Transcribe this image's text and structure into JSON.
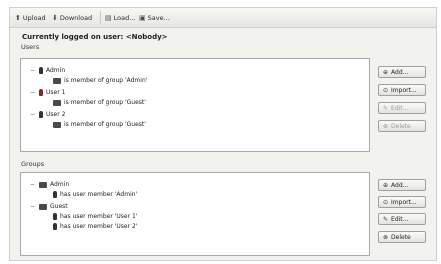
{
  "toolbar": {
    "upload": {
      "icon": "upload-icon",
      "label": "Upload"
    },
    "download": {
      "icon": "download-icon",
      "label": "Download"
    },
    "load": {
      "icon": "load-icon",
      "label": "Load..."
    },
    "save": {
      "icon": "save-icon",
      "label": "Save..."
    }
  },
  "status": "Currently logged on user: <Nobody>",
  "users_section": {
    "label": "Users",
    "tree": [
      {
        "type": "user",
        "label": "Admin",
        "expanded": true
      },
      {
        "type": "group",
        "label": "is member of group 'Admin'"
      },
      {
        "type": "user",
        "label": "User 1",
        "expanded": true
      },
      {
        "type": "group",
        "label": "is member of group 'Guest'"
      },
      {
        "type": "user",
        "label": "User 2",
        "expanded": true
      },
      {
        "type": "group",
        "label": "is member of group 'Guest'"
      }
    ],
    "buttons": {
      "add": {
        "label": "Add...",
        "icon": "add-icon",
        "enabled": true
      },
      "import": {
        "label": "Import...",
        "icon": "import-icon",
        "enabled": true
      },
      "edit": {
        "label": "Edit...",
        "icon": "edit-icon",
        "enabled": false
      },
      "delete": {
        "label": "Delete",
        "icon": "delete-icon",
        "enabled": false
      }
    }
  },
  "groups_section": {
    "label": "Groups",
    "tree": [
      {
        "type": "group",
        "label": "Admin",
        "expanded": true
      },
      {
        "type": "user",
        "label": "has user member 'Admin'"
      },
      {
        "type": "group",
        "label": "Guest",
        "expanded": true
      },
      {
        "type": "user",
        "label": "has user member 'User 1'"
      },
      {
        "type": "user",
        "label": "has user member 'User 2'"
      }
    ],
    "buttons": {
      "add": {
        "label": "Add...",
        "icon": "add-icon",
        "enabled": true
      },
      "import": {
        "label": "Import...",
        "icon": "import-icon",
        "enabled": true
      },
      "edit": {
        "label": "Edit...",
        "icon": "edit-icon",
        "enabled": true
      },
      "delete": {
        "label": "Delete",
        "icon": "delete-icon",
        "enabled": true
      }
    }
  },
  "toggle_symbol": "−"
}
